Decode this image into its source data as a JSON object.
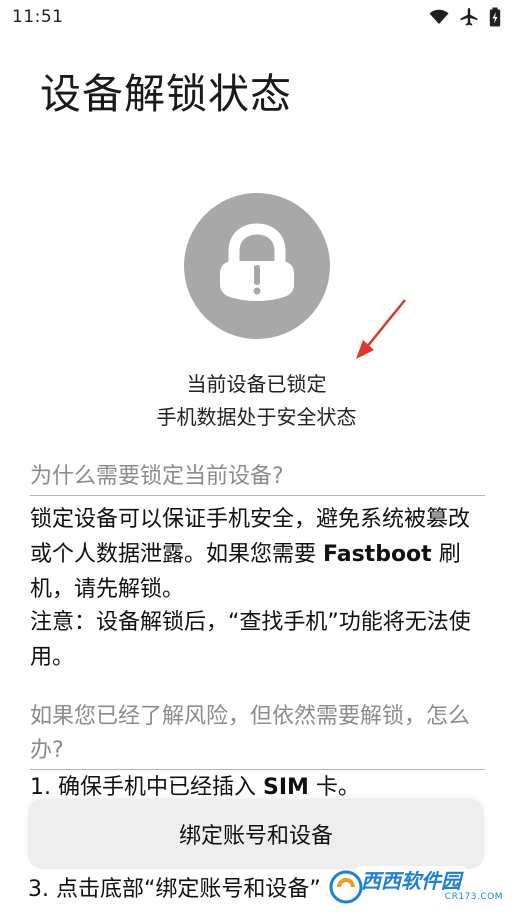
{
  "status_bar": {
    "time": "11:51",
    "icons": [
      "wifi-icon",
      "airplane-icon",
      "battery-charging-icon"
    ]
  },
  "page": {
    "title": "设备解锁状态"
  },
  "lock": {
    "icon": "lock-alert-icon",
    "circle_color": "#a8a8a8"
  },
  "status": {
    "line1": "当前设备已锁定",
    "line2": "手机数据处于安全状态"
  },
  "section1": {
    "heading": "为什么需要锁定当前设备?",
    "para1_part1": "锁定设备可以保证手机安全，避免系统被篡改或个人数据泄露。如果您需要 ",
    "para1_bold": "Fastboot",
    "para1_part2": " 刷机，请先解锁。",
    "para2": "注意：设备解锁后，“查找手机”功能将无法使用。"
  },
  "section2": {
    "heading": "如果您已经了解风险，但依然需要解锁，怎么办?",
    "step1_part1": "1. 确保手机中已经插入 ",
    "step1_bold": "SIM",
    "step1_part2": " 卡。",
    "step3_partial": "3. 点击底部“绑定账号和设备”"
  },
  "bottom_button": {
    "label": "绑定账号和设备"
  },
  "watermark": {
    "title": "西西软件园",
    "url": "CR173.COM"
  },
  "colors": {
    "annotation_arrow": "#e0352b",
    "heading_gray": "#8c8c8c",
    "watermark_blue": "#1e7fd6"
  }
}
